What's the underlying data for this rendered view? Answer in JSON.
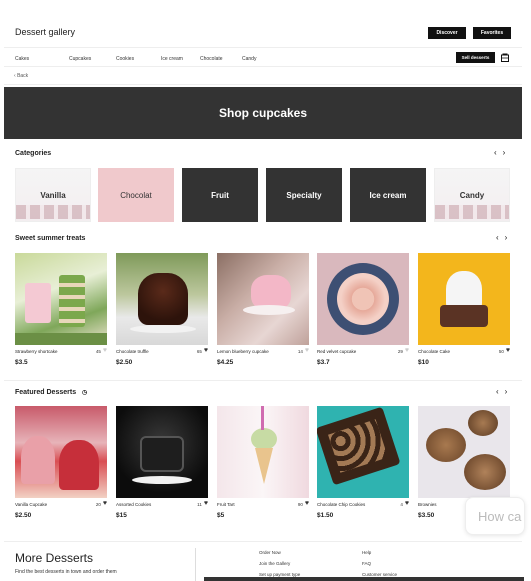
{
  "header": {
    "brand": "Dessert gallery",
    "discover_label": "Discover",
    "favorites_label": "Favorites"
  },
  "nav": {
    "links": [
      "Cakes",
      "Cupcakes",
      "Cookies",
      "Ice cream",
      "Chocolate",
      "Candy"
    ],
    "sell_label": "Sell desserts",
    "back_label": "Back"
  },
  "hero": {
    "title": "Shop cupcakes"
  },
  "categories": {
    "title": "Categories",
    "items": [
      "Vanilla",
      "Chocolat",
      "Fruit",
      "Specialty",
      "Ice cream",
      "Candy"
    ]
  },
  "summer": {
    "title": "Sweet summer treats",
    "items": [
      {
        "name": "Strawberry shortcake",
        "likes": "45",
        "liked": false,
        "price": "$3.5"
      },
      {
        "name": "Chocolate truffle",
        "likes": "65",
        "liked": true,
        "price": "$2.50"
      },
      {
        "name": "Lemon blueberry cupcake",
        "likes": "14",
        "liked": false,
        "price": "$4.25"
      },
      {
        "name": "Red velvet cupcake",
        "likes": "29",
        "liked": false,
        "price": "$3.7"
      },
      {
        "name": "Chocolate Cake",
        "likes": "50",
        "liked": true,
        "price": "$10"
      }
    ]
  },
  "featured": {
    "title": "Featured Desserts",
    "items": [
      {
        "name": "Vanilla Cupcake",
        "likes": "20",
        "liked": true,
        "price": "$2.50"
      },
      {
        "name": "Assorted Cookies",
        "likes": "11",
        "liked": true,
        "price": "$15"
      },
      {
        "name": "Fruit Tart",
        "likes": "90",
        "liked": true,
        "price": "$5"
      },
      {
        "name": "Chocolate Chip Cookies",
        "likes": "4",
        "liked": true,
        "price": "$1.50"
      },
      {
        "name": "Brownies",
        "likes": "15",
        "liked": true,
        "price": "$3.50"
      }
    ]
  },
  "footer": {
    "title": "More Desserts",
    "subtitle": "Find the best desserts in town and order them",
    "col1": [
      "Order Now",
      "Join the Gallery",
      "Set up payment type"
    ],
    "col2": [
      "Help",
      "FAQ",
      "Customer service"
    ],
    "chat_placeholder": "How ca"
  }
}
